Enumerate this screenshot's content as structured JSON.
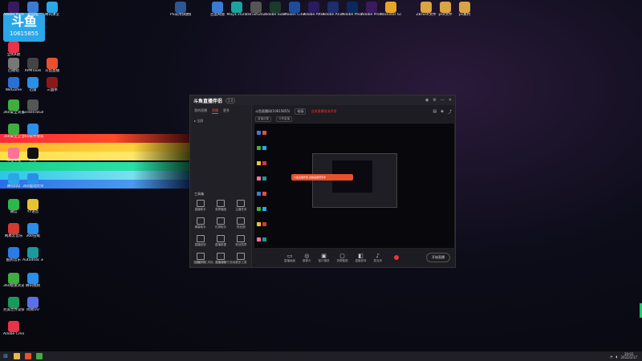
{
  "watermark": {
    "logo": "斗鱼",
    "room_id": "10615855"
  },
  "top_icons": [
    {
      "label": "PS常用快捷键大全.doc",
      "color": "#2b5797"
    },
    {
      "label": "百度网盘",
      "color": "#3a7bd5"
    },
    {
      "label": "Maya 2020",
      "color": "#1aa39c"
    },
    {
      "label": "ZBrush2021",
      "color": "#555555"
    },
    {
      "label": "Adobe Substance",
      "color": "#1a3b2a"
    },
    {
      "label": "Maxon Cinema 4D",
      "color": "#1b4d9e"
    },
    {
      "label": "Adobe After Effects 2020",
      "color": "#2a1a5e"
    },
    {
      "label": "Adobe Animate",
      "color": "#1a2f6b"
    },
    {
      "label": "Adobe Photoshop",
      "color": "#0a2a5e"
    },
    {
      "label": "Adobe Premiere",
      "color": "#3a1a5e"
    },
    {
      "label": "Rockstar Games",
      "color": "#e8a623"
    },
    {
      "label": "ZBrush文件",
      "color": "#d9a441"
    },
    {
      "label": "psd文件",
      "color": "#d9a441"
    },
    {
      "label": "ps素材",
      "color": "#d9a441"
    }
  ],
  "left_icons": [
    {
      "label": "Adobe Premiere",
      "color": "#3a1a5e"
    },
    {
      "label": "此电脑",
      "color": "#3a7bd5"
    },
    {
      "label": "腾讯课堂",
      "color": "#2aa7e8"
    },
    {
      "label": "全民K歌",
      "color": "#e8334a"
    },
    {
      "label": "回收站",
      "color": "#777777"
    },
    {
      "label": "XPMTools",
      "color": "#444444"
    },
    {
      "label": "斗鱼直播",
      "color": "#e8502e"
    },
    {
      "label": "WeGame",
      "color": "#2a6fd5"
    },
    {
      "label": "迅雷",
      "color": "#2a8fe8"
    },
    {
      "label": "三国杀",
      "color": "#8a1a1a"
    },
    {
      "label": "360安全浏览器",
      "color": "#3fae3f"
    },
    {
      "label": "ScreenToGif",
      "color": "#555555"
    },
    {
      "label": "360安全卫士",
      "color": "#3fae3f"
    },
    {
      "label": "360软件管家",
      "color": "#2a8fe8"
    },
    {
      "label": "哔哩哔哩",
      "color": "#fb7299"
    },
    {
      "label": "抖音",
      "color": "#111111"
    },
    {
      "label": "腾讯QQ",
      "color": "#2aa7e8"
    },
    {
      "label": "360驱动大师",
      "color": "#2a8fe8"
    },
    {
      "label": "微信",
      "color": "#2ab84a"
    },
    {
      "label": "YY语音",
      "color": "#e8c32e"
    },
    {
      "label": "网易云音乐",
      "color": "#d33a31"
    },
    {
      "label": "360压缩",
      "color": "#2a8fe8"
    },
    {
      "label": "酷狗音乐",
      "color": "#2a7be8"
    },
    {
      "label": "Autodesk 3ds Max",
      "color": "#1a9a9a"
    },
    {
      "label": "360极速浏览器",
      "color": "#3fae3f"
    },
    {
      "label": "腾讯视频",
      "color": "#2a8fe8"
    },
    {
      "label": "完美世界竞技平台",
      "color": "#1a9a5a"
    },
    {
      "label": "网易UU",
      "color": "#5a6fe8"
    },
    {
      "label": "Adobe Creative Cloud",
      "color": "#e8334a"
    }
  ],
  "app": {
    "name": "斗鱼直播伴侣",
    "version": "5.0",
    "side_tabs": [
      "我的直播",
      "直播",
      "更多"
    ],
    "scene": "全屏",
    "tools_title": "工具箱",
    "tools": [
      "直播助手",
      "录屏截图",
      "主播任务",
      "弹幕助手",
      "礼物助手",
      "粉丝团",
      "直播回放",
      "直播数据",
      "粉丝勋章",
      "主播学院",
      "直播宝箱",
      "更多工具"
    ],
    "side_footer": "直播助手工具箱，让你更好的直播",
    "room_title": "斗鱼直播间(10615855)",
    "category": "绘画",
    "warning": "当前直播推流异常",
    "line2_a": "直播设置",
    "line2_b": "分享直播",
    "tooltip": "斗鱼直播伴侣·直播画面预览中",
    "controls": [
      "直播画面",
      "摄像头",
      "窗口捕获",
      "录屏截图",
      "直播音效",
      "麦克风"
    ],
    "start_live": "开始直播"
  },
  "taskbar": {
    "time": "20:02",
    "date": "2022/2/17"
  }
}
